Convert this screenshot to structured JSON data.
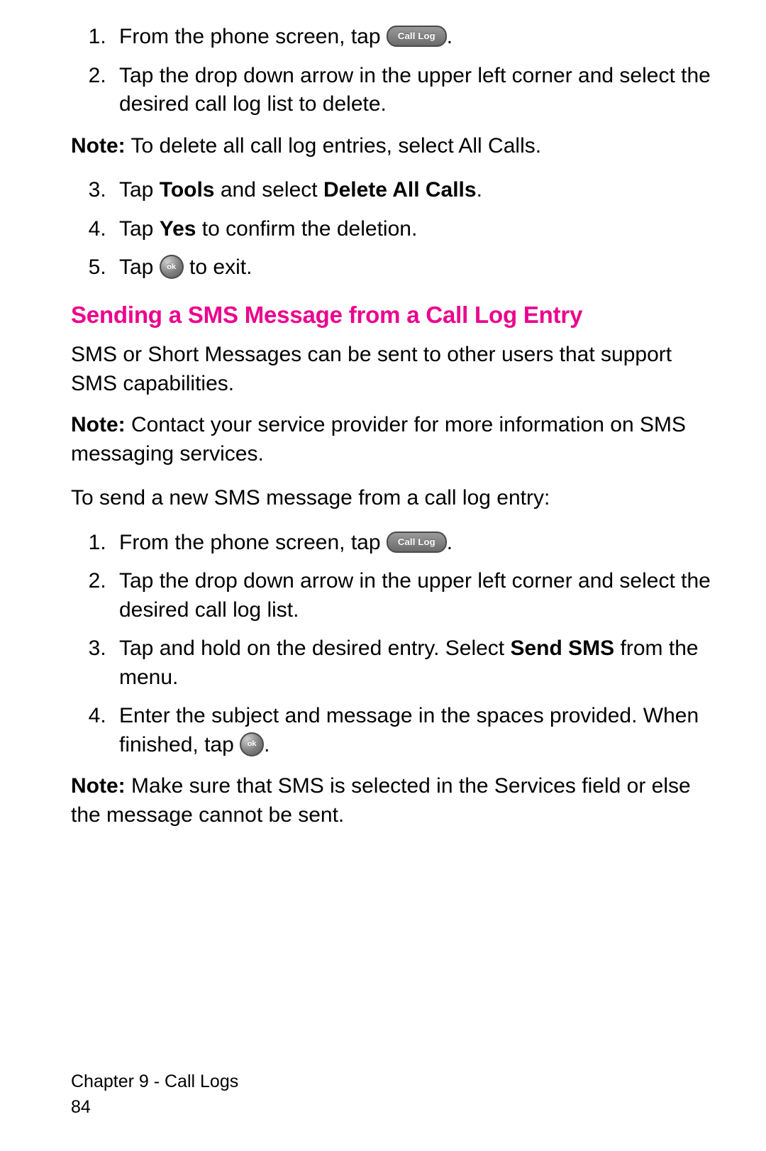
{
  "icons": {
    "call_log": "Call Log",
    "ok": "ok"
  },
  "listA": {
    "i1_pre": "From the phone screen, tap ",
    "i1_post": ".",
    "i2": "Tap the drop down arrow in the upper left corner and select the desired call log list to delete."
  },
  "note1_pre": "Note:",
  "note1_body": " To delete all call log entries, select All Calls.",
  "listB": {
    "i3_a": "Tap ",
    "i3_b": "Tools",
    "i3_c": " and select ",
    "i3_d": "Delete All Calls",
    "i3_e": ".",
    "i4_a": "Tap ",
    "i4_b": "Yes",
    "i4_c": " to confirm the deletion.",
    "i5_pre": "Tap ",
    "i5_post": " to exit."
  },
  "heading": "Sending a SMS Message from a Call Log Entry",
  "para1": "SMS or Short Messages can be sent to other users that support SMS capabilities.",
  "note2_pre": "Note:",
  "note2_body": " Contact your service provider for more information on SMS messaging services.",
  "para2": "To send a new SMS message from a call log entry:",
  "listC": {
    "i1_pre": "From the phone screen, tap ",
    "i1_post": ".",
    "i2": "Tap the drop down arrow in the upper left corner and select the desired call log list.",
    "i3_a": "Tap and hold on the desired entry. Select ",
    "i3_b": "Send SMS",
    "i3_c": " from the menu.",
    "i4_pre": "Enter the subject and message in the spaces provided. When finished, tap ",
    "i4_post": "."
  },
  "note3_pre": "Note:",
  "note3_body": " Make sure that SMS is selected in the Services field or else the message cannot be sent.",
  "footer": {
    "chapter": "Chapter 9 - Call Logs",
    "page": "84"
  }
}
